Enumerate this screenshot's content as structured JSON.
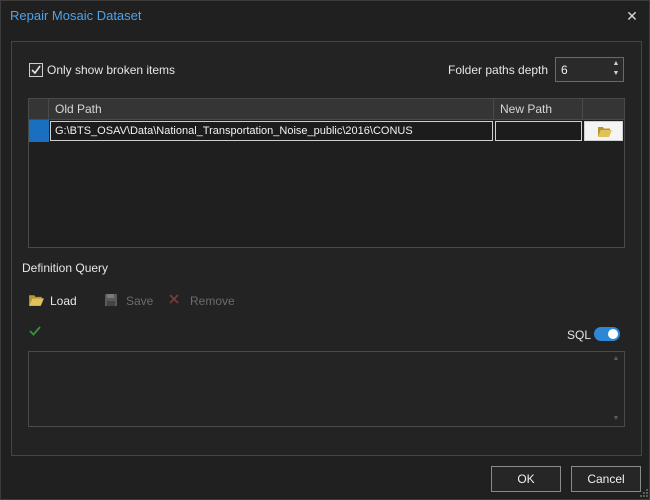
{
  "window": {
    "title": "Repair Mosaic Dataset",
    "close_glyph": "✕"
  },
  "options": {
    "only_broken_label": "Only show broken items",
    "only_broken_checked": true,
    "folder_depth_label": "Folder paths depth",
    "folder_depth_value": "6"
  },
  "grid": {
    "columns": [
      "Old Path",
      "New Path"
    ],
    "rows": [
      {
        "old_path": "G:\\BTS_OSAV\\Data\\National_Transportation_Noise_public\\2016\\CONUS",
        "new_path": ""
      }
    ]
  },
  "definition_query": {
    "label": "Definition Query",
    "toolbar": {
      "load": "Load",
      "save": "Save",
      "remove": "Remove"
    },
    "sql_label": "SQL",
    "sql_enabled": true,
    "query_text": ""
  },
  "buttons": {
    "ok": "OK",
    "cancel": "Cancel"
  },
  "colors": {
    "accent": "#2d86d6",
    "title": "#4fa3e8",
    "valid": "#3e8e3e",
    "folder": "#e2c15a"
  },
  "icons": {
    "browse": "folder-open-icon",
    "load": "folder-open-icon",
    "save": "save-icon",
    "remove": "x-icon",
    "valid": "checkmark-icon"
  }
}
